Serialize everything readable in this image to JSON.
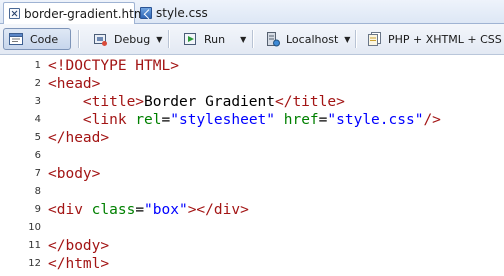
{
  "tabs": [
    {
      "label": "border-gradient.html",
      "active": true,
      "icon": "close-icon"
    },
    {
      "label": "style.css",
      "active": false,
      "icon": "css-file-icon"
    }
  ],
  "toolbar": {
    "code_label": "Code",
    "debug_label": "Debug",
    "run_label": "Run",
    "localhost_label": "Localhost",
    "php_label": "PHP + XHTML + CSS + Ja"
  },
  "editor": {
    "lines": [
      {
        "n": "1",
        "tokens": [
          "<!DOCTYPE HTML>"
        ]
      },
      {
        "n": "2",
        "tokens": [
          "<head>"
        ]
      },
      {
        "n": "3",
        "tokens": [
          "    ",
          "<title>",
          "Border Gradient",
          "</title>"
        ]
      },
      {
        "n": "4",
        "tokens": [
          "    ",
          "<link ",
          "rel",
          "=",
          "\"stylesheet\"",
          " href",
          "=",
          "\"style.css\"",
          "/>"
        ]
      },
      {
        "n": "5",
        "tokens": [
          "</head>"
        ]
      },
      {
        "n": "6",
        "tokens": []
      },
      {
        "n": "7",
        "tokens": [
          "<body>"
        ]
      },
      {
        "n": "8",
        "tokens": []
      },
      {
        "n": "9",
        "tokens": [
          "<div ",
          "class",
          "=",
          "\"box\"",
          "></div>"
        ]
      },
      {
        "n": "10",
        "tokens": []
      },
      {
        "n": "11",
        "tokens": [
          "</body>"
        ]
      },
      {
        "n": "12",
        "tokens": [
          "</html>"
        ]
      }
    ]
  },
  "colors": {
    "tag": "#a31515",
    "attribute": "#008000",
    "value": "#0000ff"
  }
}
